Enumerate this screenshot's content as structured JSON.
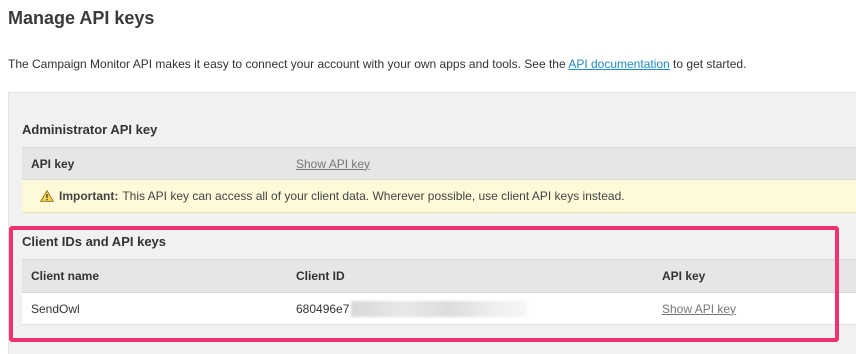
{
  "page": {
    "title": "Manage API keys",
    "intro_before": "The Campaign Monitor API makes it easy to connect your account with your own apps and tools. See the ",
    "intro_link": "API documentation",
    "intro_after": " to get started."
  },
  "admin": {
    "heading": "Administrator API key",
    "api_key_label": "API key",
    "show_api_key": "Show API key",
    "notice_bold": "Important:",
    "notice_text": "This API key can access all of your client data. Wherever possible, use client API keys instead.",
    "notice_icon": "warning-icon"
  },
  "clients": {
    "heading": "Client IDs and API keys",
    "columns": [
      "Client name",
      "Client ID",
      "API key"
    ],
    "rows": [
      {
        "name": "SendOwl",
        "client_id": "680496e7",
        "api_key_action": "Show API key"
      }
    ]
  },
  "colors": {
    "link": "#1e8ac6",
    "highlight_border": "#f0336f",
    "notice_background": "#fdf9d9"
  }
}
